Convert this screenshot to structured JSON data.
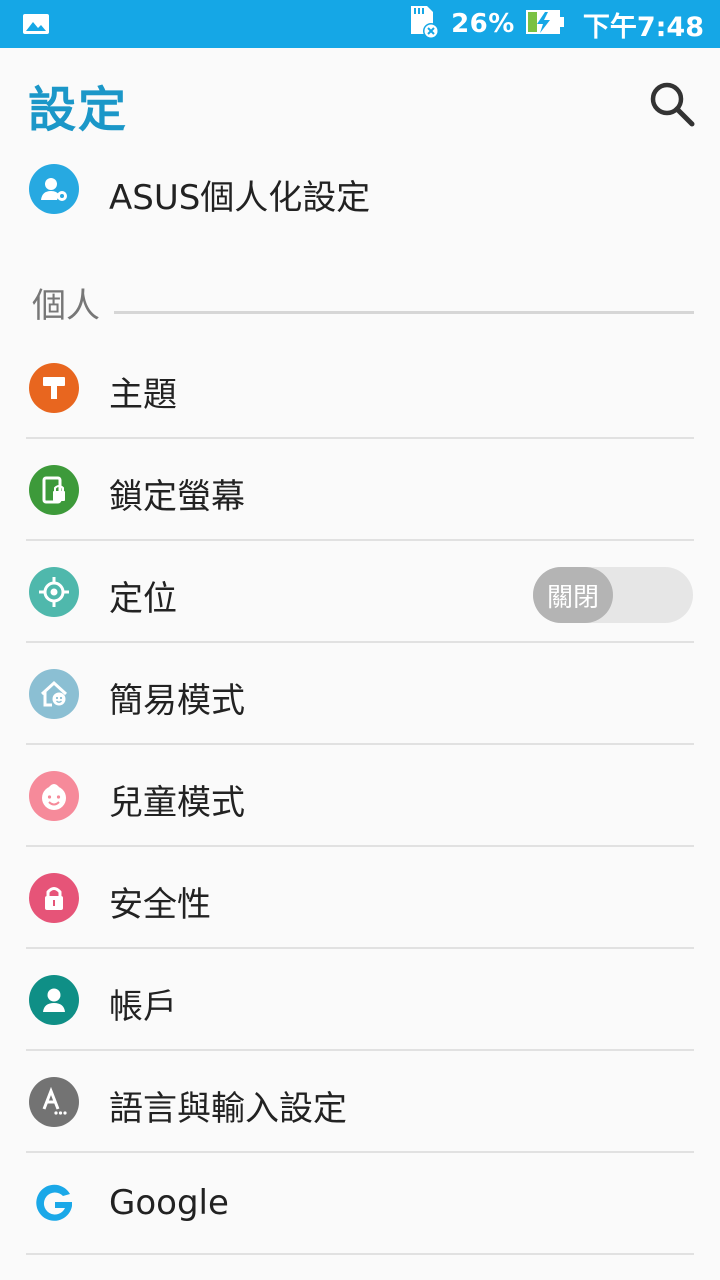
{
  "status_bar": {
    "battery_percent": "26%",
    "time": "下午7:48"
  },
  "header": {
    "title": "設定"
  },
  "asus_item": {
    "label": "ASUS個人化設定"
  },
  "section": {
    "title": "個人"
  },
  "items": [
    {
      "label": "主題"
    },
    {
      "label": "鎖定螢幕"
    },
    {
      "label": "定位",
      "toggle_label": "關閉"
    },
    {
      "label": "簡易模式"
    },
    {
      "label": "兒童模式"
    },
    {
      "label": "安全性"
    },
    {
      "label": "帳戶"
    },
    {
      "label": "語言與輸入設定"
    },
    {
      "label": "Google"
    }
  ],
  "colors": {
    "status_bar": "#15a7e6",
    "title": "#1b97c8",
    "theme_icon": "#e8661f",
    "lock_icon": "#3d9a3a",
    "location_icon": "#4fb8ac",
    "easy_mode_icon": "#8bbfd3",
    "kids_mode_icon": "#f68a9a",
    "security_icon": "#e65478",
    "accounts_icon": "#0f8f86",
    "language_icon": "#737373",
    "google_icon": "#1aa8e8"
  }
}
